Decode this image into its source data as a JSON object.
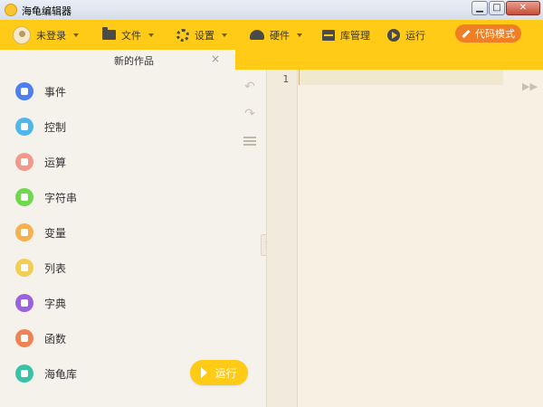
{
  "window": {
    "title": "海龟编辑器",
    "controls": {
      "minimize": "▁",
      "maximize": "□",
      "close": "✕"
    }
  },
  "toolbar": {
    "user_label": "未登录",
    "menus": [
      {
        "label": "文件",
        "icon": "folder-icon"
      },
      {
        "label": "设置",
        "icon": "gear-icon"
      },
      {
        "label": "硬件",
        "icon": "turtle-icon"
      },
      {
        "label": "库管理",
        "icon": "library-icon"
      },
      {
        "label": "运行",
        "icon": "play-icon"
      }
    ],
    "code_mode_label": "代码模式",
    "accent_color": "#ffcb17",
    "code_mode_color": "#f07e24"
  },
  "sidebar": {
    "categories": [
      {
        "label": "事件",
        "color": "#4e7ff0"
      },
      {
        "label": "控制",
        "color": "#50b7e8"
      },
      {
        "label": "运算",
        "color": "#f19a8c"
      },
      {
        "label": "字符串",
        "color": "#6fd84d"
      },
      {
        "label": "变量",
        "color": "#f5b14f"
      },
      {
        "label": "列表",
        "color": "#f4cd55"
      },
      {
        "label": "字典",
        "color": "#9b62e0"
      },
      {
        "label": "函数",
        "color": "#ef8354"
      },
      {
        "label": "海龟库",
        "color": "#38c3a6"
      }
    ]
  },
  "tabs": [
    {
      "label": "新的作品",
      "close": "×"
    }
  ],
  "blocks_pane": {
    "tools": [
      {
        "name": "undo",
        "icon": "undo-icon"
      },
      {
        "name": "redo",
        "icon": "redo-icon"
      },
      {
        "name": "align",
        "icon": "align-icon"
      }
    ],
    "run_label": "运行"
  },
  "editor": {
    "line_numbers": [
      "1"
    ]
  }
}
